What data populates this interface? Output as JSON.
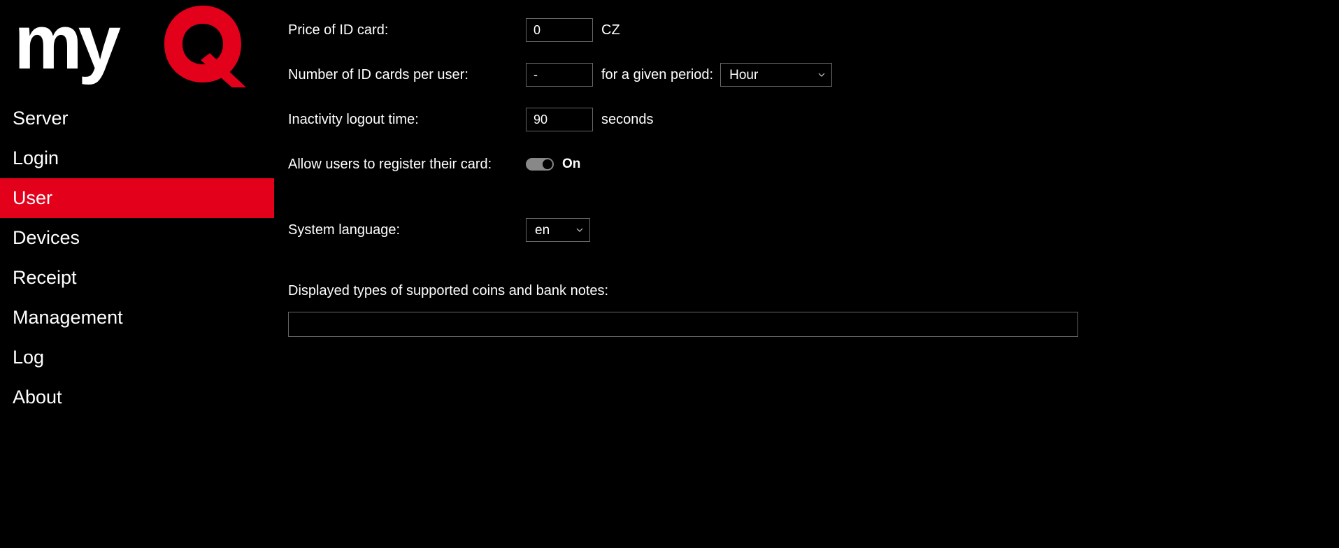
{
  "logo": {
    "text_my": "my",
    "text_q": "Q"
  },
  "sidebar": {
    "items": [
      {
        "id": "server",
        "label": "Server",
        "active": false
      },
      {
        "id": "login",
        "label": "Login",
        "active": false
      },
      {
        "id": "user",
        "label": "User",
        "active": true
      },
      {
        "id": "devices",
        "label": "Devices",
        "active": false
      },
      {
        "id": "receipt",
        "label": "Receipt",
        "active": false
      },
      {
        "id": "management",
        "label": "Management",
        "active": false
      },
      {
        "id": "log",
        "label": "Log",
        "active": false
      },
      {
        "id": "about",
        "label": "About",
        "active": false
      }
    ]
  },
  "form": {
    "price_label": "Price of ID card:",
    "price_value": "0",
    "price_unit": "CZ",
    "cards_label": "Number of ID cards per user:",
    "cards_value": "-",
    "period_label": "for a given period:",
    "period_value": "Hour",
    "inactivity_label": "Inactivity logout time:",
    "inactivity_value": "90",
    "inactivity_unit": "seconds",
    "allow_register_label": "Allow users to register their card:",
    "allow_register_state": "On",
    "language_label": "System language:",
    "language_value": "en",
    "coins_label": "Displayed types of supported coins and bank notes:",
    "coins_value": ""
  }
}
